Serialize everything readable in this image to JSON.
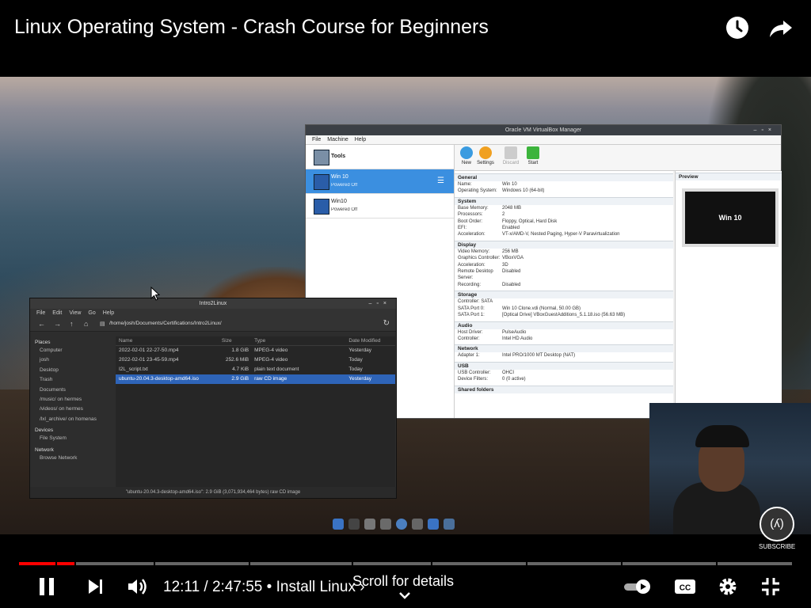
{
  "video": {
    "title": "Linux Operating System - Crash Course for Beginners",
    "progress_fraction": 0.073,
    "time_current": "12:11",
    "time_separator": " / ",
    "time_total": "2:47:55",
    "chapter_prefix": " • ",
    "chapter": "Install Linux",
    "chapter_arrow": "›",
    "scroll_hint": "Scroll for details",
    "subscribe": "SUBSCRIBE",
    "accent_color": "#ff0000"
  },
  "icons": {
    "watch_later": "clock-icon",
    "share": "share-icon",
    "pause": "pause-icon",
    "next": "next-icon",
    "volume": "volume-icon",
    "autoplay": "autoplay-toggle-icon",
    "captions": "cc-icon",
    "settings": "gear-icon",
    "exit_fullscreen": "exit-fullscreen-icon"
  },
  "vbox": {
    "title": "Oracle VM VirtualBox Manager",
    "menu": [
      "File",
      "Machine",
      "Help"
    ],
    "tools_label": "Tools",
    "vms": [
      {
        "name": "Win 10",
        "state": "Powered Off"
      },
      {
        "name": "Win10",
        "state": "Powered Off"
      }
    ],
    "toolbar": [
      "New",
      "Settings",
      "Discard",
      "Start"
    ],
    "preview_title": "Preview",
    "preview_text": "Win 10",
    "sections": [
      {
        "title": "General",
        "rows": [
          [
            "Name:",
            "Win 10"
          ],
          [
            "Operating System:",
            "Windows 10 (64-bit)"
          ]
        ]
      },
      {
        "title": "System",
        "rows": [
          [
            "Base Memory:",
            "2048 MB"
          ],
          [
            "Processors:",
            "2"
          ],
          [
            "Boot Order:",
            "Floppy, Optical, Hard Disk"
          ],
          [
            "EFI:",
            "Enabled"
          ],
          [
            "Acceleration:",
            "VT-x/AMD-V, Nested Paging, Hyper-V Paravirtualization"
          ]
        ]
      },
      {
        "title": "Display",
        "rows": [
          [
            "Video Memory:",
            "256 MB"
          ],
          [
            "Graphics Controller:",
            "VBoxVGA"
          ],
          [
            "Acceleration:",
            "3D"
          ],
          [
            "Remote Desktop Server:",
            "Disabled"
          ],
          [
            "Recording:",
            "Disabled"
          ]
        ]
      },
      {
        "title": "Storage",
        "rows": [
          [
            "Controller: SATA",
            ""
          ],
          [
            "SATA Port 0:",
            "Win 10 Clone.vdi (Normal, 50.00 GB)"
          ],
          [
            "SATA Port 1:",
            "[Optical Drive] VBoxGuestAdditions_5.1.18.iso (56.63 MB)"
          ]
        ]
      },
      {
        "title": "Audio",
        "rows": [
          [
            "Host Driver:",
            "PulseAudio"
          ],
          [
            "Controller:",
            "Intel HD Audio"
          ]
        ]
      },
      {
        "title": "Network",
        "rows": [
          [
            "Adapter 1:",
            "Intel PRO/1000 MT Desktop (NAT)"
          ]
        ]
      },
      {
        "title": "USB",
        "rows": [
          [
            "USB Controller:",
            "OHCI"
          ],
          [
            "Device Filters:",
            "0 (0 active)"
          ]
        ]
      },
      {
        "title": "Shared folders",
        "rows": []
      }
    ]
  },
  "files": {
    "title": "Intro2Linux",
    "menu": [
      "File",
      "Edit",
      "View",
      "Go",
      "Help"
    ],
    "path": "/home/josh/Documents/Certifications/Intro2Linux/",
    "sidebar": [
      {
        "heading": "Places",
        "items": [
          "Computer",
          "josh",
          "Desktop",
          "Trash",
          "Documents",
          "/music/ on hermes",
          "/videos/ on hermes",
          "/lxl_archive/ on homenas"
        ]
      },
      {
        "heading": "Devices",
        "items": [
          "File System"
        ]
      },
      {
        "heading": "Network",
        "items": [
          "Browse Network"
        ]
      }
    ],
    "columns": [
      "Name",
      "Size",
      "Type",
      "Date Modified"
    ],
    "rows": [
      {
        "name": "2022-02-01 22-27-50.mp4",
        "size": "1.8 GiB",
        "type": "MPEG-4 video",
        "date": "Yesterday"
      },
      {
        "name": "2022-02-01 23-45-59.mp4",
        "size": "252.6 MiB",
        "type": "MPEG-4 video",
        "date": "Today"
      },
      {
        "name": "I2L_script.txt",
        "size": "4.7 KiB",
        "type": "plain text document",
        "date": "Today"
      },
      {
        "name": "ubuntu-20.04.3-desktop-amd64.iso",
        "size": "2.9 GiB",
        "type": "raw CD image",
        "date": "Yesterday"
      }
    ],
    "selected_index": 3,
    "status": "\"ubuntu-20.04.3-desktop-amd64.iso\": 2.9 GiB (3,071,934,464 bytes) raw CD image"
  }
}
